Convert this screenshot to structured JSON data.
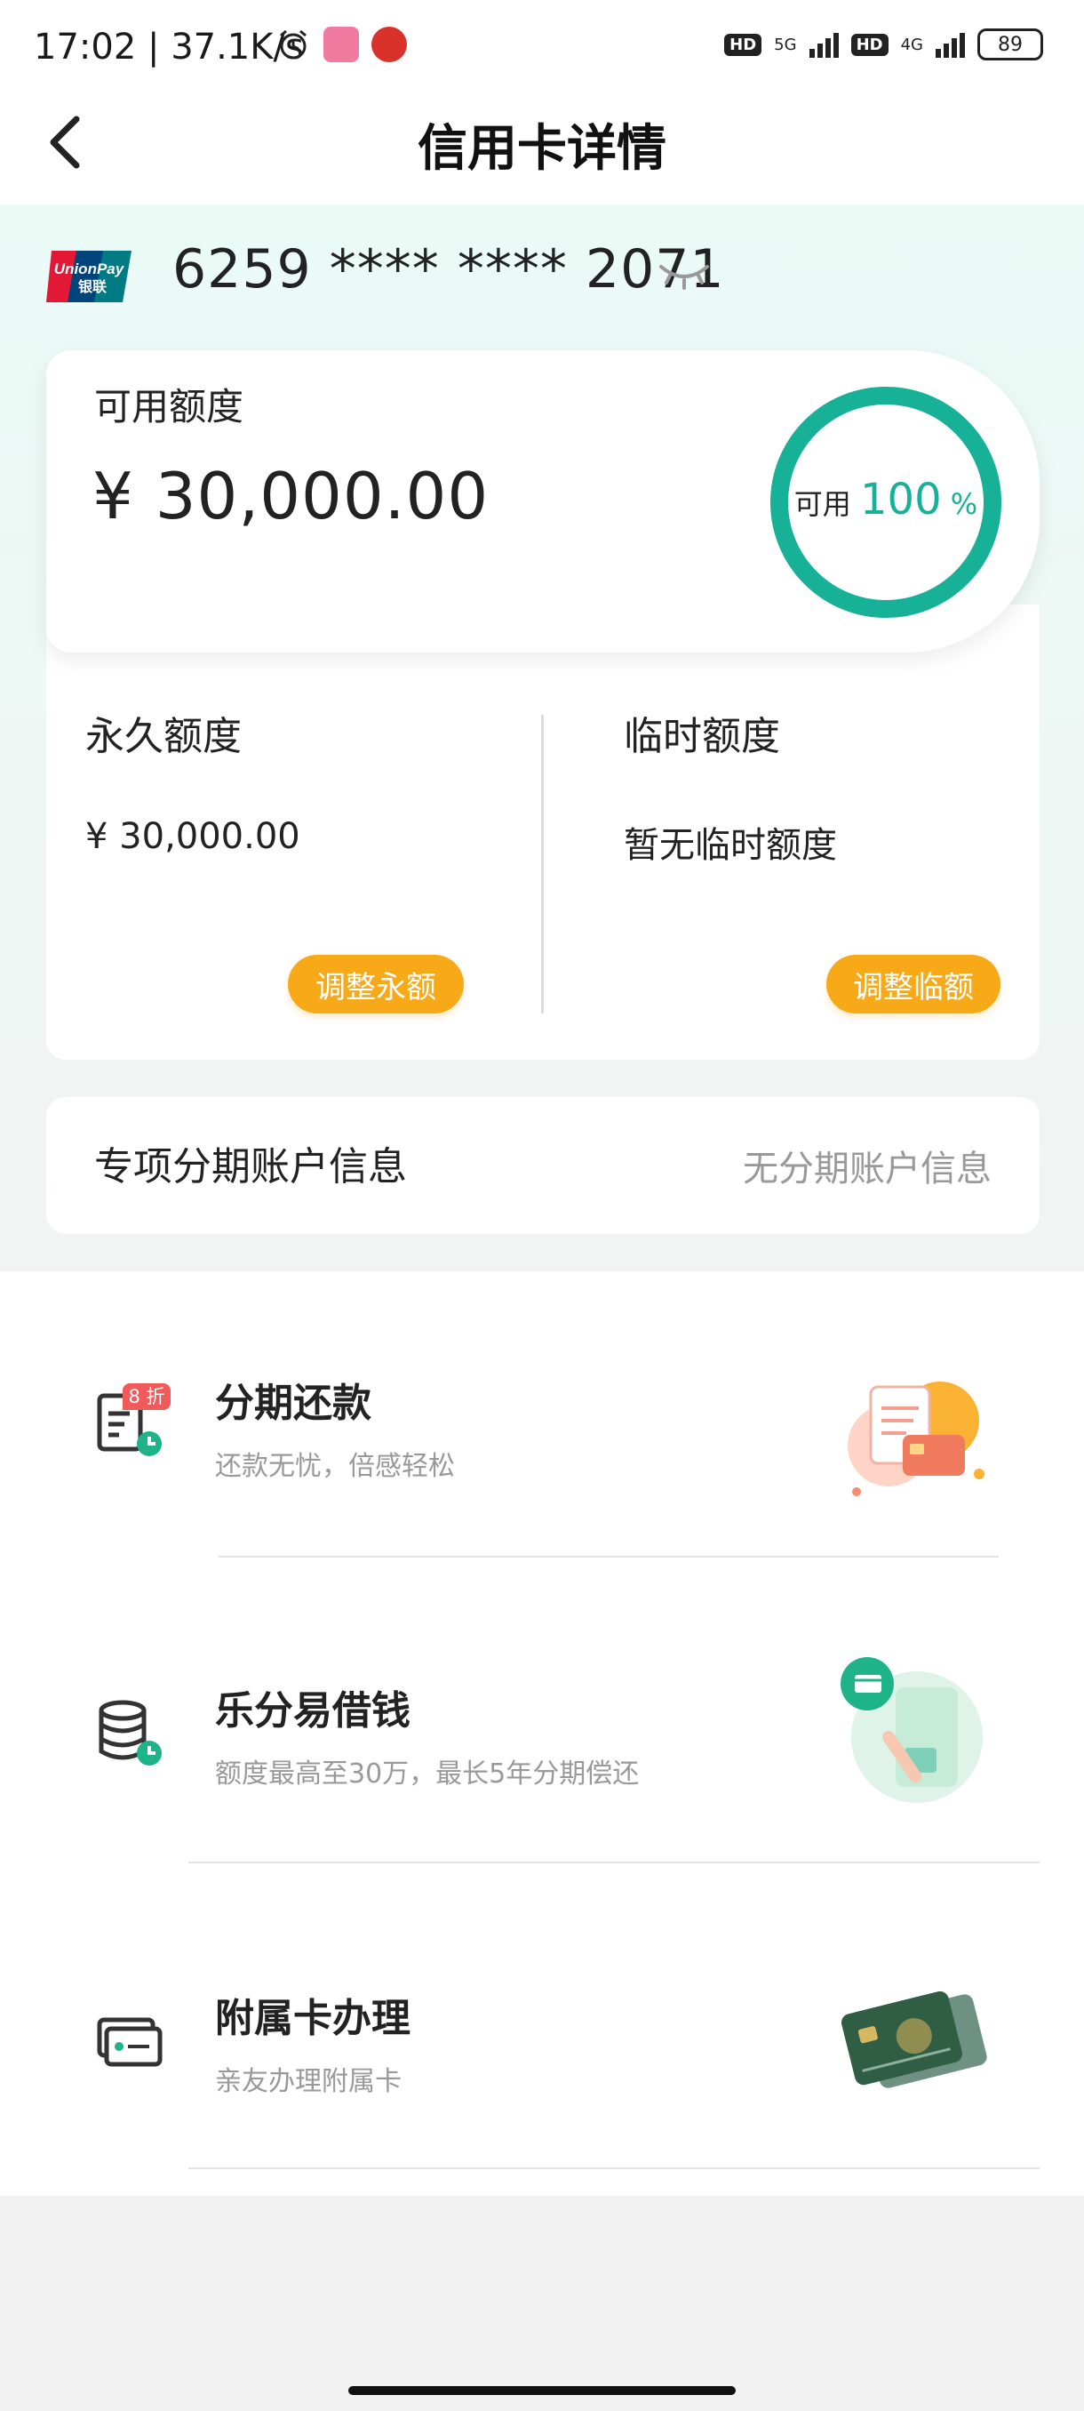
{
  "status_bar": {
    "time": "17:02",
    "network_speed": "37.1K/s",
    "sim1_badge": "HD",
    "sim1_type": "5G",
    "sim2_badge": "HD",
    "sim2_type": "4G",
    "battery": "89"
  },
  "header": {
    "title": "信用卡详情",
    "back_icon": "chevron-left-icon"
  },
  "card": {
    "network_logo": "unionpay-logo",
    "logo_text_1": "UnionPay",
    "logo_text_2": "银联",
    "number": "6259 **** **** 2071",
    "visibility_icon": "eye-closed-icon"
  },
  "available_credit": {
    "label": "可用额度",
    "amount": "¥ 30,000.00",
    "ring_label": "可用",
    "ring_percent": "100",
    "ring_percent_sign": "%",
    "ring_fraction": 1.0,
    "ring_color": "#17b197"
  },
  "permanent_limit": {
    "label": "永久额度",
    "value": "¥ 30,000.00",
    "button": "调整永额"
  },
  "temporary_limit": {
    "label": "临时额度",
    "value": "暂无临时额度",
    "button": "调整临额"
  },
  "installment_account": {
    "label": "专项分期账户信息",
    "value": "无分期账户信息"
  },
  "services": [
    {
      "title": "分期还款",
      "subtitle": "还款无忧，倍感轻松",
      "icon": "bill-clock-icon",
      "badge": "8 折",
      "illustration": "bill-card-illustration"
    },
    {
      "title": "乐分易借钱",
      "subtitle": "额度最高至30万，最长5年分期偿还",
      "icon": "coins-clock-icon",
      "illustration": "phone-card-illustration"
    },
    {
      "title": "附属卡办理",
      "subtitle": "亲友办理附属卡",
      "icon": "cards-icon",
      "illustration": "credit-cards-illustration"
    }
  ],
  "colors": {
    "accent": "#17b197",
    "button_orange": "#f8a918",
    "badge_red": "#f05a5a"
  }
}
